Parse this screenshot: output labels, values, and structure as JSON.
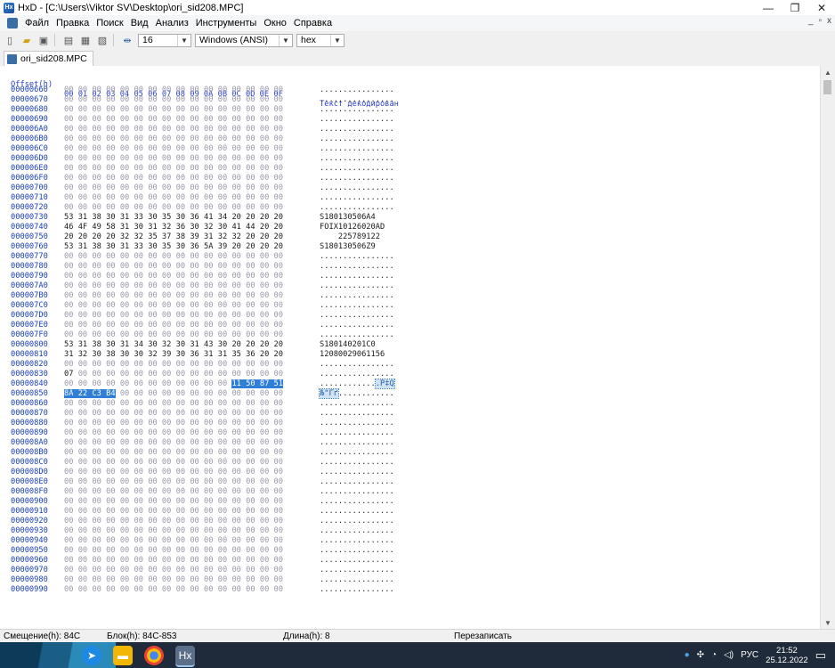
{
  "window": {
    "title": "HxD - [C:\\Users\\Viktor SV\\Desktop\\ori_sid208.MPC]",
    "minimize": "—",
    "maximize": "❐",
    "close": "✕"
  },
  "menu": {
    "items": [
      "Файл",
      "Правка",
      "Поиск",
      "Вид",
      "Анализ",
      "Инструменты",
      "Окно",
      "Справка"
    ],
    "mdi_min": "_",
    "mdi_max": "▫",
    "mdi_close": "x"
  },
  "toolbar": {
    "bytes_per_row": "16",
    "charset": "Windows (ANSI)",
    "display_mode": "hex"
  },
  "tab": {
    "label": "ori_sid208.MPC"
  },
  "hex_view": {
    "header": {
      "offset": "Offset(h)",
      "columns": "00 01 02 03 04 05 06 07 08 09 0A 0B 0C 0D 0E 0F",
      "text": "Текст декодирован"
    },
    "rows": [
      {
        "offset": "00000660",
        "hex": "00 00 00 00 00 00 00 00 00 00 00 00 00 00 00 00",
        "text": "................"
      },
      {
        "offset": "00000670",
        "hex": "00 00 00 00 00 00 00 00 00 00 00 00 00 00 00 00",
        "text": "................"
      },
      {
        "offset": "00000680",
        "hex": "00 00 00 00 00 00 00 00 00 00 00 00 00 00 00 00",
        "text": "................"
      },
      {
        "offset": "00000690",
        "hex": "00 00 00 00 00 00 00 00 00 00 00 00 00 00 00 00",
        "text": "................"
      },
      {
        "offset": "000006A0",
        "hex": "00 00 00 00 00 00 00 00 00 00 00 00 00 00 00 00",
        "text": "................"
      },
      {
        "offset": "000006B0",
        "hex": "00 00 00 00 00 00 00 00 00 00 00 00 00 00 00 00",
        "text": "................"
      },
      {
        "offset": "000006C0",
        "hex": "00 00 00 00 00 00 00 00 00 00 00 00 00 00 00 00",
        "text": "................"
      },
      {
        "offset": "000006D0",
        "hex": "00 00 00 00 00 00 00 00 00 00 00 00 00 00 00 00",
        "text": "................"
      },
      {
        "offset": "000006E0",
        "hex": "00 00 00 00 00 00 00 00 00 00 00 00 00 00 00 00",
        "text": "................"
      },
      {
        "offset": "000006F0",
        "hex": "00 00 00 00 00 00 00 00 00 00 00 00 00 00 00 00",
        "text": "................"
      },
      {
        "offset": "00000700",
        "hex": "00 00 00 00 00 00 00 00 00 00 00 00 00 00 00 00",
        "text": "................"
      },
      {
        "offset": "00000710",
        "hex": "00 00 00 00 00 00 00 00 00 00 00 00 00 00 00 00",
        "text": "................"
      },
      {
        "offset": "00000720",
        "hex": "00 00 00 00 00 00 00 00 00 00 00 00 00 00 00 00",
        "text": "................"
      },
      {
        "offset": "00000730",
        "hex": "53 31 38 30 31 33 30 35 30 36 41 34 20 20 20 20",
        "text": "S180130506A4    "
      },
      {
        "offset": "00000740",
        "hex": "46 4F 49 58 31 30 31 32 36 30 32 30 41 44 20 20",
        "text": "FOIX10126020AD  "
      },
      {
        "offset": "00000750",
        "hex": "20 20 20 20 32 32 35 37 38 39 31 32 32 20 20 20",
        "text": "    225789122   "
      },
      {
        "offset": "00000760",
        "hex": "53 31 38 30 31 33 30 35 30 36 5A 39 20 20 20 20",
        "text": "S180130506Z9    "
      },
      {
        "offset": "00000770",
        "hex": "00 00 00 00 00 00 00 00 00 00 00 00 00 00 00 00",
        "text": "................"
      },
      {
        "offset": "00000780",
        "hex": "00 00 00 00 00 00 00 00 00 00 00 00 00 00 00 00",
        "text": "................"
      },
      {
        "offset": "00000790",
        "hex": "00 00 00 00 00 00 00 00 00 00 00 00 00 00 00 00",
        "text": "................"
      },
      {
        "offset": "000007A0",
        "hex": "00 00 00 00 00 00 00 00 00 00 00 00 00 00 00 00",
        "text": "................"
      },
      {
        "offset": "000007B0",
        "hex": "00 00 00 00 00 00 00 00 00 00 00 00 00 00 00 00",
        "text": "................"
      },
      {
        "offset": "000007C0",
        "hex": "00 00 00 00 00 00 00 00 00 00 00 00 00 00 00 00",
        "text": "................"
      },
      {
        "offset": "000007D0",
        "hex": "00 00 00 00 00 00 00 00 00 00 00 00 00 00 00 00",
        "text": "................"
      },
      {
        "offset": "000007E0",
        "hex": "00 00 00 00 00 00 00 00 00 00 00 00 00 00 00 00",
        "text": "................"
      },
      {
        "offset": "000007F0",
        "hex": "00 00 00 00 00 00 00 00 00 00 00 00 00 00 00 00",
        "text": "................"
      },
      {
        "offset": "00000800",
        "hex": "53 31 38 30 31 34 30 32 30 31 43 30 20 20 20 20",
        "text": "S180140201C0    "
      },
      {
        "offset": "00000810",
        "hex": "31 32 30 38 30 30 32 39 30 36 31 31 35 36 20 20",
        "text": "12080029061156  "
      },
      {
        "offset": "00000820",
        "hex": "00 00 00 00 00 00 00 00 00 00 00 00 00 00 00 00",
        "text": "................"
      },
      {
        "offset": "00000830",
        "hex": "07 00 00 00 00 00 00 00 00 00 00 00 00 00 00 00",
        "text": "................"
      },
      {
        "offset": "00000840",
        "hex": "00 00 00 00 00 00 00 00 00 00 00 00 11 50 87 51",
        "text": "............",
        "text_sel": ".P‡Q",
        "sel_from": 12
      },
      {
        "offset": "00000850",
        "hex": "8A 22 C3 B4 00 00 00 00 00 00 00 00 00 00 00 00",
        "text": "............",
        "text_sel": "Љ\"Гґ",
        "sel_to": 4
      },
      {
        "offset": "00000860",
        "hex": "00 00 00 00 00 00 00 00 00 00 00 00 00 00 00 00",
        "text": "................"
      },
      {
        "offset": "00000870",
        "hex": "00 00 00 00 00 00 00 00 00 00 00 00 00 00 00 00",
        "text": "................"
      },
      {
        "offset": "00000880",
        "hex": "00 00 00 00 00 00 00 00 00 00 00 00 00 00 00 00",
        "text": "................"
      },
      {
        "offset": "00000890",
        "hex": "00 00 00 00 00 00 00 00 00 00 00 00 00 00 00 00",
        "text": "................"
      },
      {
        "offset": "000008A0",
        "hex": "00 00 00 00 00 00 00 00 00 00 00 00 00 00 00 00",
        "text": "................"
      },
      {
        "offset": "000008B0",
        "hex": "00 00 00 00 00 00 00 00 00 00 00 00 00 00 00 00",
        "text": "................"
      },
      {
        "offset": "000008C0",
        "hex": "00 00 00 00 00 00 00 00 00 00 00 00 00 00 00 00",
        "text": "................"
      },
      {
        "offset": "000008D0",
        "hex": "00 00 00 00 00 00 00 00 00 00 00 00 00 00 00 00",
        "text": "................"
      },
      {
        "offset": "000008E0",
        "hex": "00 00 00 00 00 00 00 00 00 00 00 00 00 00 00 00",
        "text": "................"
      },
      {
        "offset": "000008F0",
        "hex": "00 00 00 00 00 00 00 00 00 00 00 00 00 00 00 00",
        "text": "................"
      },
      {
        "offset": "00000900",
        "hex": "00 00 00 00 00 00 00 00 00 00 00 00 00 00 00 00",
        "text": "................"
      },
      {
        "offset": "00000910",
        "hex": "00 00 00 00 00 00 00 00 00 00 00 00 00 00 00 00",
        "text": "................"
      },
      {
        "offset": "00000920",
        "hex": "00 00 00 00 00 00 00 00 00 00 00 00 00 00 00 00",
        "text": "................"
      },
      {
        "offset": "00000930",
        "hex": "00 00 00 00 00 00 00 00 00 00 00 00 00 00 00 00",
        "text": "................"
      },
      {
        "offset": "00000940",
        "hex": "00 00 00 00 00 00 00 00 00 00 00 00 00 00 00 00",
        "text": "................"
      },
      {
        "offset": "00000950",
        "hex": "00 00 00 00 00 00 00 00 00 00 00 00 00 00 00 00",
        "text": "................"
      },
      {
        "offset": "00000960",
        "hex": "00 00 00 00 00 00 00 00 00 00 00 00 00 00 00 00",
        "text": "................"
      },
      {
        "offset": "00000970",
        "hex": "00 00 00 00 00 00 00 00 00 00 00 00 00 00 00 00",
        "text": "................"
      },
      {
        "offset": "00000980",
        "hex": "00 00 00 00 00 00 00 00 00 00 00 00 00 00 00 00",
        "text": "................"
      },
      {
        "offset": "00000990",
        "hex": "00 00 00 00 00 00 00 00 00 00 00 00 00 00 00 00",
        "text": "................"
      }
    ]
  },
  "status": {
    "offset": "Смещение(h): 84C",
    "block": "Блок(h): 84C-853",
    "length": "Длина(h): 8",
    "mode": "Перезаписать"
  },
  "taskbar": {
    "language": "РУС",
    "time": "21:52",
    "date": "25.12.2022"
  },
  "colors": {
    "offset_text": "#1a3fb5",
    "selection": "#2f7ed8",
    "taskbar": "#1f2a3a"
  }
}
